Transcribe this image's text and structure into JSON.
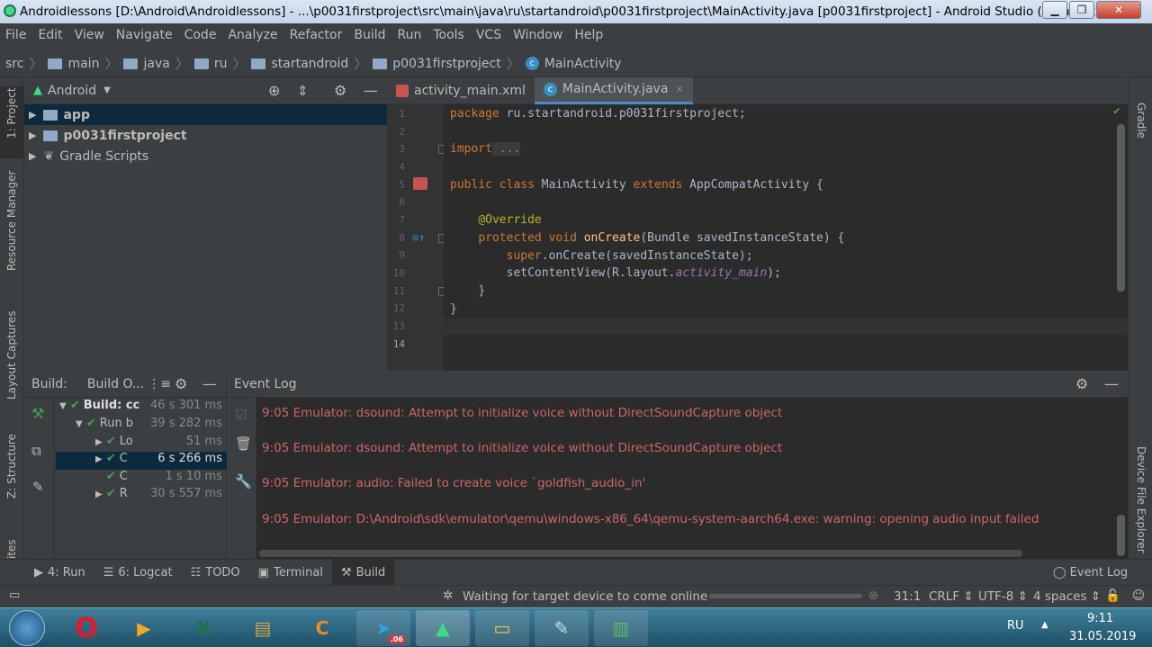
{
  "window": {
    "title": "Androidlessons [D:\\Android\\Androidlessons] - ...\\p0031firstproject\\src\\main\\java\\ru\\startandroid\\p0031firstproject\\MainActivity.java [p0031firstproject] - Android Studio (Administrator)",
    "minimize": "▁",
    "maximize": "❐",
    "close": "✕"
  },
  "menu": [
    "File",
    "Edit",
    "View",
    "Navigate",
    "Code",
    "Analyze",
    "Refactor",
    "Build",
    "Run",
    "Tools",
    "VCS",
    "Window",
    "Help"
  ],
  "breadcrumb": [
    "src",
    "main",
    "java",
    "ru",
    "startandroid",
    "p0031firstproject",
    "MainActivity"
  ],
  "run_config": "p0031firstproject",
  "left_strip": {
    "project": "1: Project",
    "resource": "Resource Manager",
    "captures": "Layout Captures",
    "structure": "Z: Structure",
    "favorites": "ites"
  },
  "right_strip": {
    "gradle": "Gradle",
    "device_explorer": "Device File Explorer"
  },
  "project_panel": {
    "view": "Android",
    "items": [
      {
        "label": "app",
        "bold": true
      },
      {
        "label": "p0031firstproject",
        "bold": true
      },
      {
        "label": "Gradle Scripts",
        "bold": false
      }
    ]
  },
  "editor": {
    "tabs": [
      {
        "label": "activity_main.xml",
        "active": false
      },
      {
        "label": "MainActivity.java",
        "active": true
      }
    ],
    "line_numbers": [
      "1",
      "2",
      "3",
      "4",
      "5",
      "6",
      "7",
      "8",
      "9",
      "10",
      "11",
      "12",
      "13",
      "14"
    ],
    "code": {
      "l1_kw": "package",
      "l1_rest": " ru.startandroid.p0031firstproject;",
      "l3_kw": "import",
      "l3_rest": " ...",
      "l6_kw1": "public",
      "l6_kw2": "class",
      "l6_name": "MainActivity",
      "l6_kw3": "extends",
      "l6_rest": "AppCompatActivity {",
      "l8_ann": "@Override",
      "l9_kw1": "protected",
      "l9_kw2": "void",
      "l9_fn": "onCreate",
      "l9_rest": "(Bundle savedInstanceState) {",
      "l10_kw": "super",
      "l10_rest": ".onCreate(savedInstanceState);",
      "l11_a": "setContentView(R.layout.",
      "l11_b": "activity_main",
      "l11_c": ");",
      "l12": "}",
      "l13": "}"
    }
  },
  "build_panel": {
    "title": "Build:",
    "tab": "Build O...",
    "rows": [
      {
        "label": "Build: cc",
        "time": "46 s 301 ms",
        "bold": true
      },
      {
        "label": "Run b",
        "time": "39 s 282 ms",
        "bold": false
      },
      {
        "label": "Lo",
        "time": "51 ms",
        "bold": false
      },
      {
        "label": "C",
        "time": "6 s 266 ms",
        "bold": false
      },
      {
        "label": "C",
        "time": "1 s 10 ms",
        "bold": false
      },
      {
        "label": "R",
        "time": "30 s 557 ms",
        "bold": false
      }
    ]
  },
  "event_log": {
    "title": "Event Log",
    "lines": [
      "9:05 Emulator: dsound: Attempt to initialize voice without DirectSoundCapture object",
      "9:05 Emulator: dsound: Attempt to initialize voice without DirectSoundCapture object",
      "9:05 Emulator: audio: Failed to create voice `goldfish_audio_in'",
      "9:05 Emulator: D:\\Android\\sdk\\emulator\\qemu\\windows-x86_64\\qemu-system-aarch64.exe: warning: opening audio input failed"
    ]
  },
  "tool_tabs": {
    "run": "4: Run",
    "logcat": "6: Logcat",
    "todo": "TODO",
    "terminal": "Terminal",
    "build": "Build",
    "event_log": "Event Log"
  },
  "status": {
    "message": "Waiting for target device to come online",
    "position": "31:1",
    "line_sep": "CRLF ⇕",
    "encoding": "UTF-8 ⇕",
    "indent": "4 spaces ⇕"
  },
  "taskbar": {
    "lang": "RU",
    "time": "9:11",
    "date": "31.05.2019",
    "badge": ".06"
  }
}
